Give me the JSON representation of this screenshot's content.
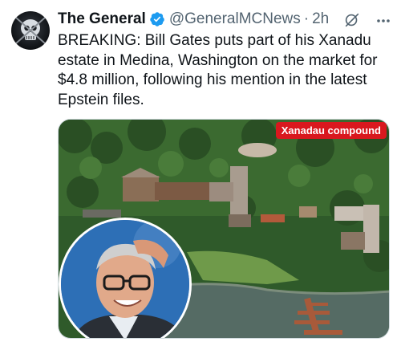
{
  "tweet": {
    "display_name": "The General",
    "handle": "@GeneralMCNews",
    "separator": "·",
    "time": "2h",
    "text": "BREAKING: Bill Gates puts part of his Xanadu estate in Medina, Washington on the market for $4.8 million, following his mention in the latest Epstein files."
  },
  "media": {
    "tag_label": "Xanadau compound"
  },
  "icons": {
    "verified": "verified-badge-icon",
    "grok": "grok-icon",
    "more": "more-icon"
  },
  "colors": {
    "verified_blue": "#1d9bf0",
    "tag_red": "#d9181e",
    "secondary_text": "#536471"
  }
}
